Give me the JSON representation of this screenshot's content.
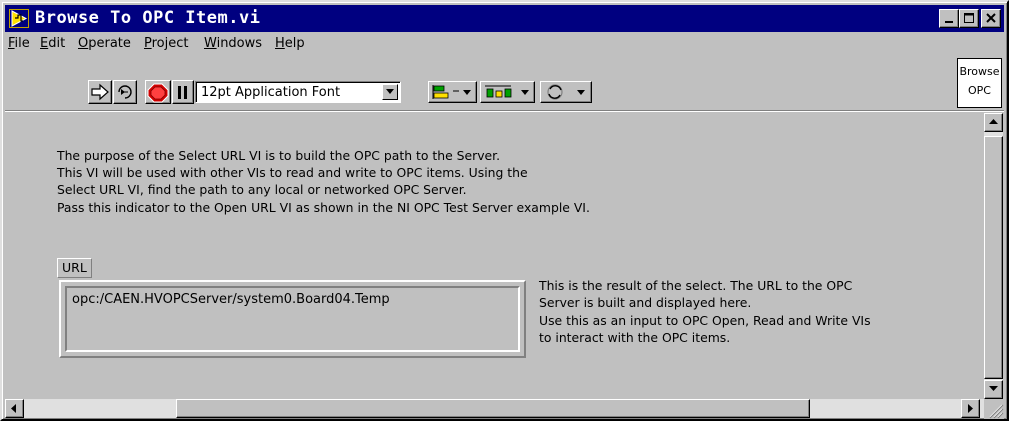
{
  "window": {
    "title": "Browse To OPC Item.vi"
  },
  "menu": {
    "items": [
      {
        "u": "F",
        "rest": "ile"
      },
      {
        "u": "E",
        "rest": "dit"
      },
      {
        "u": "O",
        "rest": "perate"
      },
      {
        "u": "P",
        "rest": "roject"
      },
      {
        "u": "W",
        "rest": "indows"
      },
      {
        "u": "H",
        "rest": "elp"
      }
    ]
  },
  "toolbar": {
    "font_value": "12pt Application Font"
  },
  "browse_box": {
    "line1": "Browse",
    "line2": "OPC"
  },
  "panel": {
    "description": [
      "The purpose of the Select URL VI is to build the OPC path to the Server.",
      "This VI will be used with other VIs to read and write to OPC items. Using the",
      "Select URL VI, find the path to any local or networked OPC Server.",
      "Pass this indicator to the Open URL VI as shown in the NI OPC Test Server example VI."
    ],
    "url_label": "URL",
    "url_value": "opc:/CAEN.HVOPCServer/system0.Board04.Temp",
    "url_note": [
      "This is the result of the select.  The URL to the OPC",
      "Server is built and displayed here.",
      "Use this as an input to OPC Open, Read and Write VIs",
      "to interact with the OPC items."
    ]
  },
  "colors": {
    "titlebar": "#000080",
    "face": "#c0c0c0"
  }
}
